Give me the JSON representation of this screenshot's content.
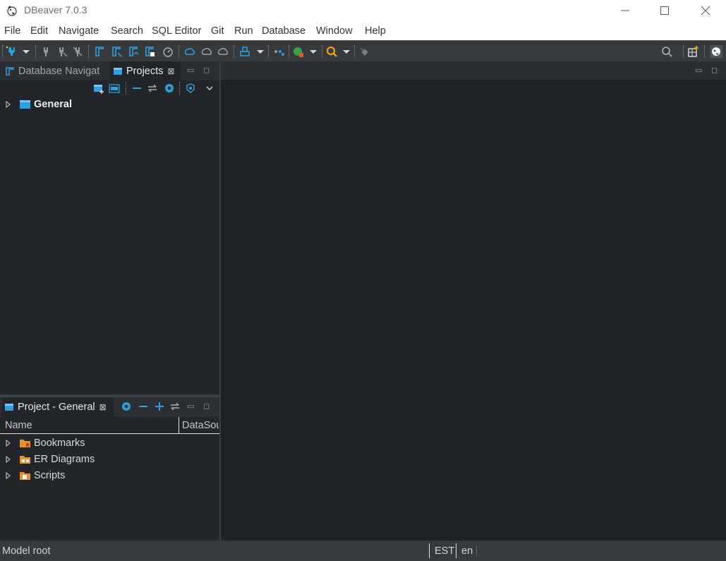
{
  "window": {
    "title": "DBeaver 7.0.3",
    "controls": [
      "minimize",
      "maximize",
      "close"
    ]
  },
  "menu": [
    "File",
    "Edit",
    "Navigate",
    "Search",
    "SQL Editor",
    "Git",
    "Run",
    "Database",
    "Window",
    "Help"
  ],
  "toolbar": {
    "icons": [
      "new-connection-icon",
      "dropdown-icon",
      "connect-icon",
      "disconnect-icon",
      "invalidate-icon",
      "commit-mode-icon",
      "transaction-icon",
      "commit-icon",
      "rollback-icon",
      "transaction-log-icon",
      "dashboard-icon",
      "cloud-icon",
      "upload-icon",
      "download-icon",
      "sql-editor-icon",
      "dropdown-icon",
      "tools-icon",
      "run-icon",
      "dropdown-icon",
      "search-icon",
      "dropdown-icon",
      "pin-icon",
      "search-icon",
      "perspective-add-icon",
      "dbeaver-perspective-icon"
    ]
  },
  "navigator": {
    "tabs": [
      {
        "label": "Database Navigat",
        "active": false
      },
      {
        "label": "Projects",
        "active": true,
        "close": "⊠"
      }
    ],
    "tree": [
      {
        "label": "General",
        "bold": true
      }
    ]
  },
  "project_panel": {
    "tab_label": "Project - General",
    "close": "⊠",
    "columns": [
      "Name",
      "DataSou"
    ],
    "items": [
      {
        "label": "Bookmarks",
        "icon": "bookmarks-folder-icon"
      },
      {
        "label": "ER Diagrams",
        "icon": "er-diagrams-folder-icon"
      },
      {
        "label": "Scripts",
        "icon": "scripts-folder-icon"
      }
    ]
  },
  "status": {
    "text": "Model root",
    "timezone": "EST",
    "language": "en"
  },
  "colors": {
    "background": "#22262a",
    "toolbar": "#363a3c",
    "accent_blue": "#2f9fe0",
    "folder_orange": "#e8932b"
  }
}
